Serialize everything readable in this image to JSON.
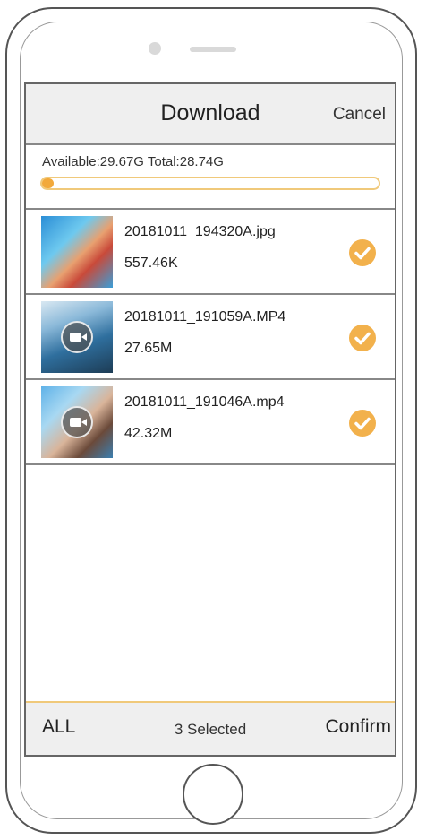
{
  "header": {
    "title": "Download",
    "cancel_label": "Cancel"
  },
  "storage": {
    "text": "Available:29.67G Total:28.74G",
    "progress_fraction": 0.03,
    "bar_color": "#f2a93b"
  },
  "files": [
    {
      "name": "20181011_194320A.jpg",
      "size": "557.46K",
      "type": "image",
      "selected": true
    },
    {
      "name": "20181011_191059A.MP4",
      "size": "27.65M",
      "type": "video",
      "selected": true
    },
    {
      "name": "20181011_191046A.mp4",
      "size": "42.32M",
      "type": "video",
      "selected": true
    }
  ],
  "footer": {
    "all_label": "ALL",
    "selected_label": "3 Selected",
    "confirm_label": "Confirm"
  },
  "icons": {
    "check": "checkmark-circle-icon",
    "video": "video-camera-icon"
  },
  "colors": {
    "accent": "#f2b14c"
  }
}
